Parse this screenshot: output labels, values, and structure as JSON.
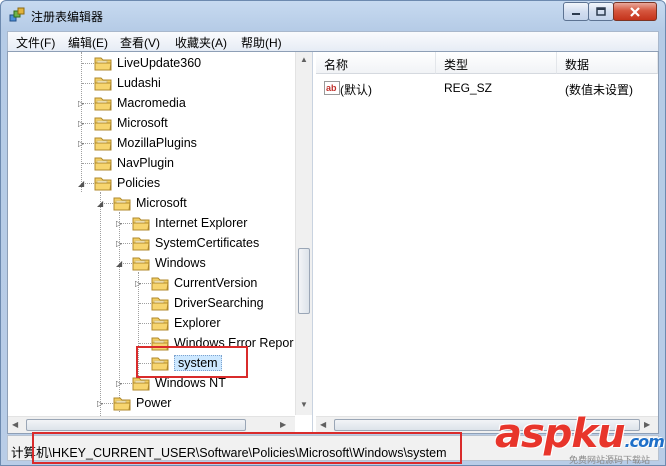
{
  "window": {
    "title": "注册表编辑器"
  },
  "menu": [
    "文件(F)",
    "编辑(E)",
    "查看(V)",
    "收藏夹(A)",
    "帮助(H)"
  ],
  "tree": {
    "nodes": [
      {
        "label": "LiveUpdate360",
        "level": 0,
        "expander": ""
      },
      {
        "label": "Ludashi",
        "level": 0,
        "expander": ""
      },
      {
        "label": "Macromedia",
        "level": 0,
        "expander": "▷"
      },
      {
        "label": "Microsoft",
        "level": 0,
        "expander": "▷"
      },
      {
        "label": "MozillaPlugins",
        "level": 0,
        "expander": "▷"
      },
      {
        "label": "NavPlugin",
        "level": 0,
        "expander": ""
      },
      {
        "label": "Policies",
        "level": 0,
        "expander": "◢"
      },
      {
        "label": "Microsoft",
        "level": 1,
        "expander": "◢"
      },
      {
        "label": "Internet Explorer",
        "level": 2,
        "expander": "▷"
      },
      {
        "label": "SystemCertificates",
        "level": 2,
        "expander": "▷"
      },
      {
        "label": "Windows",
        "level": 2,
        "expander": "◢"
      },
      {
        "label": "CurrentVersion",
        "level": 3,
        "expander": "▷"
      },
      {
        "label": "DriverSearching",
        "level": 3,
        "expander": ""
      },
      {
        "label": "Explorer",
        "level": 3,
        "expander": ""
      },
      {
        "label": "Windows Error Repor",
        "level": 3,
        "expander": ""
      },
      {
        "label": "system",
        "level": 3,
        "expander": "",
        "selected": true
      },
      {
        "label": "Windows NT",
        "level": 2,
        "expander": "▷"
      },
      {
        "label": "Power",
        "level": 1,
        "expander": "▷"
      }
    ]
  },
  "list": {
    "columns": [
      "名称",
      "类型",
      "数据"
    ],
    "rows": [
      {
        "name": "(默认)",
        "type": "REG_SZ",
        "data": "(数值未设置)",
        "icon": "string-value-icon"
      }
    ]
  },
  "status": {
    "path": "计算机\\HKEY_CURRENT_USER\\Software\\Policies\\Microsoft\\Windows\\system"
  },
  "watermark": {
    "main": "aspku",
    "main_domain": ".com",
    "sub": "免费网站源码下载站"
  },
  "colors": {
    "highlight": "#d92b2b",
    "selection": "#cde8ff",
    "folder": "#f2cd62"
  }
}
